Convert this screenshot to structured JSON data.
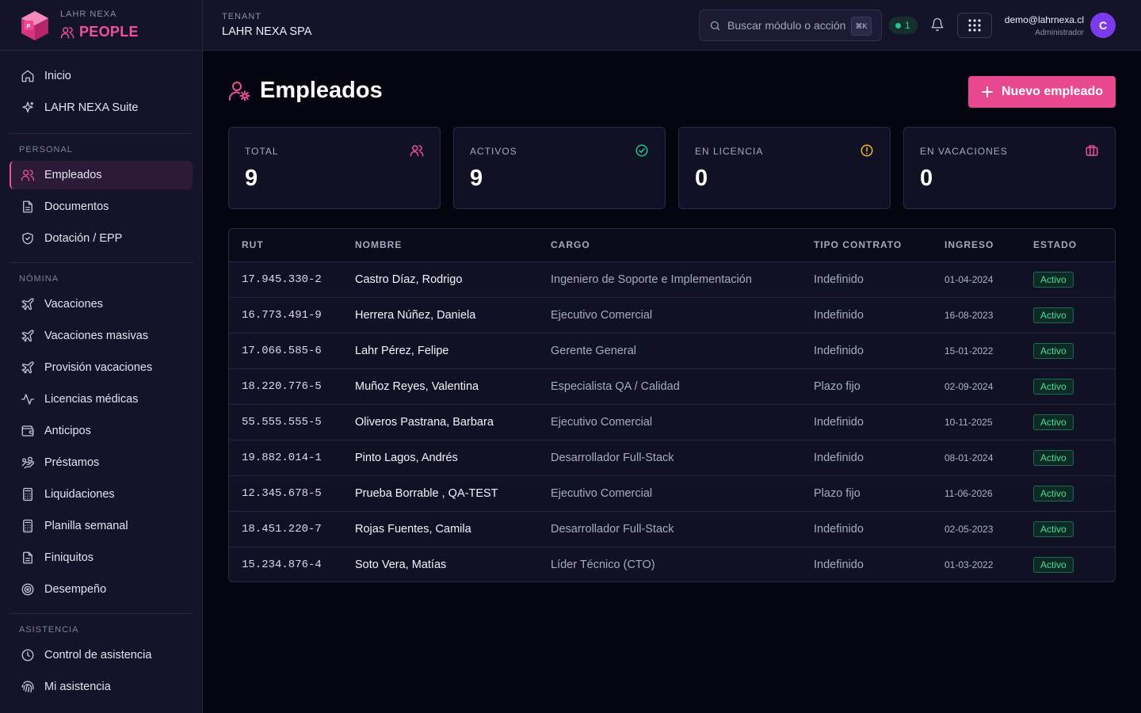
{
  "brand": {
    "company": "LAHR NEXA",
    "product": "PEOPLE"
  },
  "sidebar": {
    "top_items": [
      {
        "label": "Inicio",
        "icon": "home-icon"
      },
      {
        "label": "LAHR NEXA Suite",
        "icon": "sparkle-icon"
      }
    ],
    "sections": [
      {
        "title": "PERSONAL",
        "items": [
          {
            "label": "Empleados",
            "icon": "users-icon",
            "active": true
          },
          {
            "label": "Documentos",
            "icon": "document-icon"
          },
          {
            "label": "Dotación / EPP",
            "icon": "shield-icon"
          }
        ]
      },
      {
        "title": "NÓMINA",
        "items": [
          {
            "label": "Vacaciones",
            "icon": "plane-icon"
          },
          {
            "label": "Vacaciones masivas",
            "icon": "plane-icon"
          },
          {
            "label": "Provisión vacaciones",
            "icon": "plane-icon"
          },
          {
            "label": "Licencias médicas",
            "icon": "activity-icon"
          },
          {
            "label": "Anticipos",
            "icon": "wallet-icon"
          },
          {
            "label": "Préstamos",
            "icon": "hand-coins-icon"
          },
          {
            "label": "Liquidaciones",
            "icon": "calculator-icon"
          },
          {
            "label": "Planilla semanal",
            "icon": "calculator-icon"
          },
          {
            "label": "Finiquitos",
            "icon": "document-icon"
          },
          {
            "label": "Desempeño",
            "icon": "target-icon"
          }
        ]
      },
      {
        "title": "ASISTENCIA",
        "items": [
          {
            "label": "Control de asistencia",
            "icon": "clock-icon"
          },
          {
            "label": "Mi asistencia",
            "icon": "fingerprint-icon"
          }
        ]
      }
    ]
  },
  "topbar": {
    "tenant_label": "TENANT",
    "tenant_name": "LAHR NEXA SPA",
    "search_placeholder": "Buscar módulo o acción",
    "search_shortcut": "⌘K",
    "status_count": "1",
    "user_email": "demo@lahrnexa.cl",
    "user_role": "Administrador",
    "avatar_initial": "C"
  },
  "page": {
    "title": "Empleados",
    "new_button": "Nuevo empleado"
  },
  "stats": [
    {
      "label": "TOTAL",
      "value": "9",
      "icon": "users-icon",
      "color": "#f0509b"
    },
    {
      "label": "ACTIVOS",
      "value": "9",
      "icon": "check-circle-icon",
      "color": "#22c58b"
    },
    {
      "label": "EN LICENCIA",
      "value": "0",
      "icon": "alert-circle-icon",
      "color": "#f5b82e"
    },
    {
      "label": "EN VACACIONES",
      "value": "0",
      "icon": "briefcase-icon",
      "color": "#f0509b"
    }
  ],
  "table": {
    "headers": [
      "RUT",
      "NOMBRE",
      "CARGO",
      "TIPO CONTRATO",
      "INGRESO",
      "ESTADO"
    ],
    "rows": [
      [
        "17.945.330-2",
        "Castro Díaz, Rodrigo",
        "Ingeniero de Soporte e Implementación",
        "Indefinido",
        "01-04-2024",
        "Activo"
      ],
      [
        "16.773.491-9",
        "Herrera Núñez, Daniela",
        "Ejecutivo Comercial",
        "Indefinido",
        "16-08-2023",
        "Activo"
      ],
      [
        "17.066.585-6",
        "Lahr Pérez, Felipe",
        "Gerente General",
        "Indefinido",
        "15-01-2022",
        "Activo"
      ],
      [
        "18.220.776-5",
        "Muñoz Reyes, Valentina",
        "Especialista QA / Calidad",
        "Plazo fijo",
        "02-09-2024",
        "Activo"
      ],
      [
        "55.555.555-5",
        "Oliveros Pastrana, Barbara",
        "Ejecutivo Comercial",
        "Indefinido",
        "10-11-2025",
        "Activo"
      ],
      [
        "19.882.014-1",
        "Pinto Lagos, Andrés",
        "Desarrollador Full-Stack",
        "Indefinido",
        "08-01-2024",
        "Activo"
      ],
      [
        "12.345.678-5",
        "Prueba Borrable , QA-TEST",
        "Ejecutivo Comercial",
        "Plazo fijo",
        "11-06-2026",
        "Activo"
      ],
      [
        "18.451.220-7",
        "Rojas Fuentes, Camila",
        "Desarrollador Full-Stack",
        "Indefinido",
        "02-05-2023",
        "Activo"
      ],
      [
        "15.234.876-4",
        "Soto Vera, Matías",
        "Líder Técnico (CTO)",
        "Indefinido",
        "01-03-2022",
        "Activo"
      ]
    ]
  }
}
